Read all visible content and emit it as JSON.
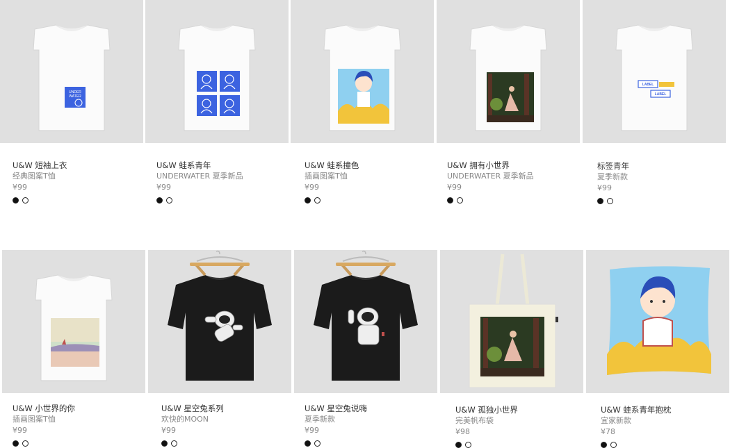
{
  "products": [
    {
      "title": "U&W 短袖上衣",
      "subtitle": "经典图案T恤",
      "price": "¥99",
      "colors": [
        "black",
        "white"
      ],
      "print_text": [
        "UNDER",
        "WATER"
      ]
    },
    {
      "title": "U&W 蛙系青年",
      "subtitle": "UNDERWATER 夏季新品",
      "price": "¥99",
      "colors": [
        "black",
        "white"
      ]
    },
    {
      "title": "U&W 蛙系撞色",
      "subtitle": "插画图案T恤",
      "price": "¥99",
      "colors": [
        "black",
        "white"
      ]
    },
    {
      "title": "U&W 拥有小世界",
      "subtitle": "UNDERWATER 夏季新品",
      "price": "¥99",
      "colors": [
        "black",
        "white"
      ]
    },
    {
      "title": "标签青年",
      "subtitle": "夏季新款",
      "price": "¥99",
      "colors": [
        "black",
        "white"
      ],
      "print_text": [
        "LABEL",
        "LABEL"
      ]
    },
    {
      "title": "U&W 小世界的你",
      "subtitle": "插画图案T恤",
      "price": "¥99",
      "colors": [
        "black",
        "white"
      ]
    },
    {
      "title": "U&W 星空兔系列",
      "subtitle": "欢快的MOON",
      "price": "¥99",
      "colors": [
        "black",
        "white"
      ]
    },
    {
      "title": "U&W 星空兔说嗨",
      "subtitle": "夏季新款",
      "price": "¥99",
      "colors": [
        "black",
        "white"
      ]
    },
    {
      "title": "U&W 孤独小世界",
      "subtitle": "完美帆布袋",
      "price": "¥98",
      "colors": [
        "black",
        "white"
      ]
    },
    {
      "title": "U&W 蛙系青年抱枕",
      "subtitle": "宜家新款",
      "price": "¥78",
      "colors": [
        "black",
        "white"
      ]
    }
  ]
}
